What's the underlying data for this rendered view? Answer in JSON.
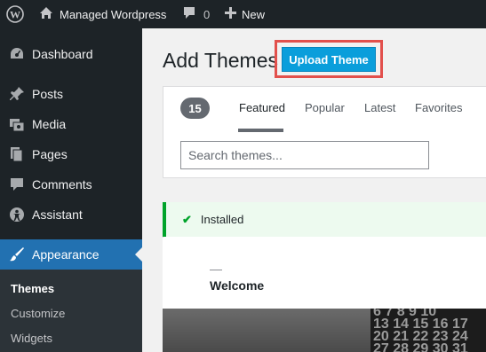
{
  "adminbar": {
    "site_name": "Managed Wordpress",
    "comments_count": "0",
    "new_label": "New"
  },
  "sidebar": {
    "items": [
      {
        "label": "Dashboard",
        "icon": "dashboard-icon"
      },
      {
        "label": "Posts",
        "icon": "pin-icon"
      },
      {
        "label": "Media",
        "icon": "media-icon"
      },
      {
        "label": "Pages",
        "icon": "pages-icon"
      },
      {
        "label": "Comments",
        "icon": "comment-icon"
      },
      {
        "label": "Assistant",
        "icon": "assistant-icon"
      },
      {
        "label": "Appearance",
        "icon": "brush-icon"
      }
    ],
    "submenu": [
      "Themes",
      "Customize",
      "Widgets"
    ]
  },
  "main": {
    "title": "Add Themes",
    "upload_label": "Upload Theme",
    "count": "15",
    "tabs": [
      "Featured",
      "Popular",
      "Latest",
      "Favorites"
    ],
    "search_placeholder": "Search themes...",
    "installed_label": "Installed",
    "preview_heading": "Welcome",
    "calendar_rows": [
      "6 7 8 9 10",
      "13 14 15 16 17",
      "20 21 22 23 24",
      "27 28 29 30 31"
    ]
  },
  "colors": {
    "accent": "#2271b1",
    "upload_button": "#0a9edb",
    "highlight_box": "#e2504c",
    "installed": "#00a32a"
  }
}
